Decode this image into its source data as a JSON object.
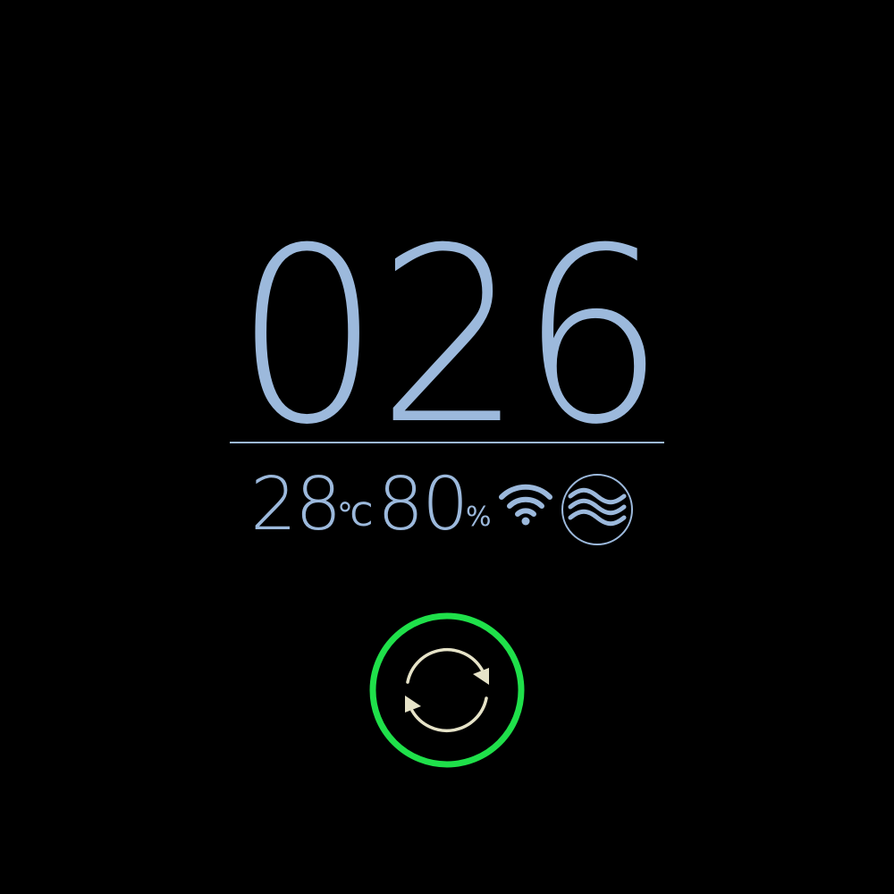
{
  "display": {
    "main_value": "026"
  },
  "status": {
    "temperature": "28",
    "temperature_unit": "℃",
    "humidity": "80",
    "humidity_unit": "%"
  },
  "icons": {
    "wifi": "wifi-icon",
    "mode": "waves-icon",
    "refresh": "refresh-icon"
  },
  "colors": {
    "primary": "#9cb9dc",
    "accent": "#1fe04a",
    "refresh_arrows": "#e6e3c8",
    "background": "#000000"
  }
}
